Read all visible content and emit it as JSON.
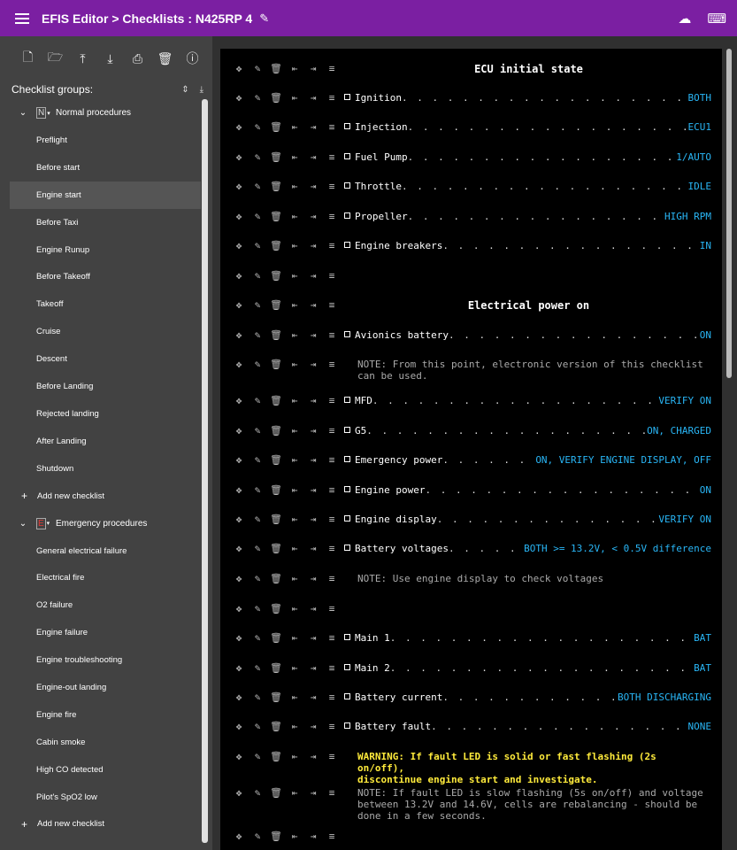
{
  "header": {
    "title": "EFIS Editor > Checklists : N425RP 4"
  },
  "sidebar": {
    "groups_label": "Checklist groups:",
    "groups": [
      {
        "name": "Normal procedures",
        "icon": "N",
        "items": [
          "Preflight",
          "Before start",
          "Engine start",
          "Before Taxi",
          "Engine Runup",
          "Before Takeoff",
          "Takeoff",
          "Cruise",
          "Descent",
          "Before Landing",
          "Rejected landing",
          "After Landing",
          "Shutdown"
        ],
        "add_label": "Add new checklist"
      },
      {
        "name": "Emergency procedures",
        "icon": "E",
        "items": [
          "General electrical failure",
          "Electrical fire",
          "O2 failure",
          "Engine failure",
          "Engine troubleshooting",
          "Engine-out landing",
          "Engine fire",
          "Cabin smoke",
          "High CO detected",
          "Pilot's SpO2 low"
        ],
        "add_label": "Add new checklist"
      }
    ],
    "selected_item": "Engine start"
  },
  "editor": {
    "rows": [
      {
        "type": "title",
        "text": "ECU initial state"
      },
      {
        "type": "item",
        "label": "Ignition",
        "value": "BOTH"
      },
      {
        "type": "item",
        "label": "Injection",
        "value": "ECU1"
      },
      {
        "type": "item",
        "label": "Fuel Pump",
        "value": "1/AUTO"
      },
      {
        "type": "item",
        "label": "Throttle",
        "value": "IDLE"
      },
      {
        "type": "item",
        "label": "Propeller",
        "value": "HIGH RPM"
      },
      {
        "type": "item",
        "label": "Engine breakers",
        "value": "IN"
      },
      {
        "type": "blank"
      },
      {
        "type": "title",
        "text": "Electrical power on"
      },
      {
        "type": "item",
        "label": "Avionics battery",
        "value": "ON"
      },
      {
        "type": "note",
        "text": "NOTE: From this point, electronic version of this checklist\ncan be used."
      },
      {
        "type": "item",
        "label": "MFD",
        "value": "VERIFY ON"
      },
      {
        "type": "item",
        "label": "G5",
        "value": "ON, CHARGED"
      },
      {
        "type": "item",
        "label": "Emergency power",
        "value": "ON, VERIFY ENGINE DISPLAY, OFF"
      },
      {
        "type": "item",
        "label": "Engine power",
        "value": "ON"
      },
      {
        "type": "item",
        "label": "Engine display",
        "value": "VERIFY ON"
      },
      {
        "type": "item",
        "label": "Battery voltages",
        "value": "BOTH >= 13.2V, < 0.5V difference"
      },
      {
        "type": "note",
        "text": "NOTE: Use engine display to check voltages"
      },
      {
        "type": "blank"
      },
      {
        "type": "item",
        "label": "Main 1",
        "value": "BAT"
      },
      {
        "type": "item",
        "label": "Main 2",
        "value": "BAT"
      },
      {
        "type": "item",
        "label": "Battery current",
        "value": "BOTH DISCHARGING"
      },
      {
        "type": "item",
        "label": "Battery fault",
        "value": "NONE"
      },
      {
        "type": "warning",
        "text": "WARNING: If fault LED is solid or fast flashing (2s on/off),\ndiscontinue engine start and investigate."
      },
      {
        "type": "note",
        "text": "NOTE: If fault LED is slow flashing (5s on/off) and voltage\nbetween 13.2V and 14.6V, cells are rebalancing - should be\ndone in a few seconds."
      },
      {
        "type": "blank"
      }
    ]
  }
}
